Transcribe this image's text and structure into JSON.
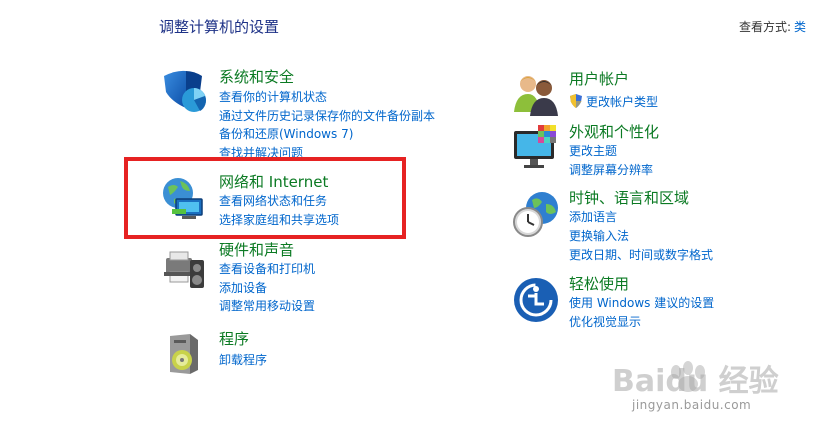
{
  "header": {
    "title": "调整计算机的设置",
    "view_by_label": "查看方式:",
    "view_by_value": "类"
  },
  "categories_left": [
    {
      "title": "系统和安全",
      "icon": "shield-icon",
      "links": [
        "查看你的计算机状态",
        "通过文件历史记录保存你的文件备份副本",
        "备份和还原(Windows 7)",
        "查找并解决问题"
      ]
    },
    {
      "title": "网络和 Internet",
      "icon": "network-globe-icon",
      "links": [
        "查看网络状态和任务",
        "选择家庭组和共享选项"
      ]
    },
    {
      "title": "硬件和声音",
      "icon": "printer-speaker-icon",
      "links": [
        "查看设备和打印机",
        "添加设备",
        "调整常用移动设置"
      ]
    },
    {
      "title": "程序",
      "icon": "programs-disc-icon",
      "links": [
        "卸载程序"
      ]
    }
  ],
  "categories_right": [
    {
      "title": "用户帐户",
      "icon": "users-icon",
      "links": [
        "更改帐户类型"
      ]
    },
    {
      "title": "外观和个性化",
      "icon": "monitor-palette-icon",
      "links": [
        "更改主题",
        "调整屏幕分辨率"
      ]
    },
    {
      "title": "时钟、语言和区域",
      "icon": "clock-globe-icon",
      "links": [
        "添加语言",
        "更换输入法",
        "更改日期、时间或数字格式"
      ]
    },
    {
      "title": "轻松使用",
      "icon": "ease-of-access-icon",
      "links": [
        "使用 Windows 建议的设置",
        "优化视觉显示"
      ]
    }
  ],
  "watermark": {
    "logo": "Baidu 经验",
    "url": "jingyan.baidu.com"
  },
  "colors": {
    "category_title": "#0b7a23",
    "link": "#0066cc",
    "highlight": "#e62222"
  }
}
